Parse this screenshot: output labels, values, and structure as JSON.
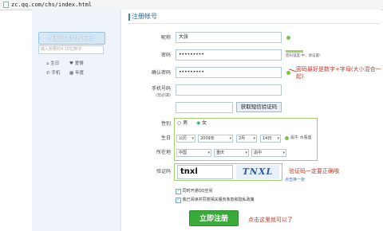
{
  "browser": {
    "url": "zc.qq.com/chs/index.html"
  },
  "sidebar": {
    "promo_text": "搜索您喜欢的号码!",
    "qq_input_placeholder": "输入想要的4-10位数字",
    "links": [
      "生日",
      "爱情",
      "手机",
      "年度"
    ]
  },
  "form": {
    "title": "注册帐号",
    "nickname": {
      "label": "昵称",
      "value": "大张"
    },
    "password": {
      "label": "密码",
      "value": "•••••••••",
      "strength_hint": "密码强度:中，请设置!"
    },
    "confirm_password": {
      "label": "确认密码",
      "value": "•••••••••"
    },
    "phone": {
      "label": "手机号码",
      "sublabel": "(非必填)",
      "value": ""
    },
    "sms_code": {
      "value": "",
      "button_label": "获取短信验证码"
    },
    "gender": {
      "label": "性别",
      "options": [
        "男",
        "女"
      ],
      "selected": "女"
    },
    "birthday": {
      "label": "生日",
      "calendar": "公历",
      "year": "2009年",
      "month": "2月",
      "day": "14日",
      "zodiac": "属牛 水瓶座"
    },
    "location": {
      "label": "所在地",
      "country": "中国",
      "province": "重庆",
      "city": "渝中"
    },
    "captcha": {
      "label": "验证码",
      "value": "tnxl",
      "image_text": "TNXL",
      "refresh_link": "点击换一张"
    },
    "checkboxes": [
      {
        "label": "同时开通QQ空间",
        "checked": true
      },
      {
        "label": "我已阅读并同意相关服务条款和隐私政策",
        "checked": true
      }
    ],
    "submit_label": "立即注册"
  },
  "annotations": {
    "password_tip": "密码最好是数字+字母(大小混合一起)",
    "captcha_tip": "验证码一定要正确哦",
    "submit_tip": "点击这里就可以了",
    "colors": {
      "annotation": "#c0392b",
      "highlight": "#9fd06c",
      "button": "#3aaa3a"
    }
  }
}
